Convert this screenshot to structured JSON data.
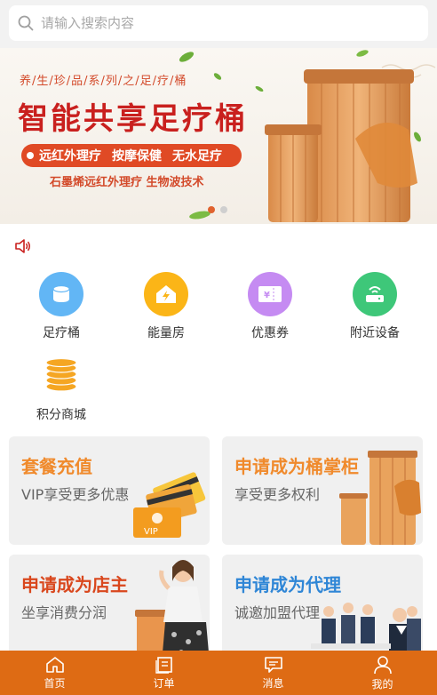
{
  "search": {
    "placeholder": "请输入搜索内容"
  },
  "banner": {
    "series": "养/生/珍/品/系/列/之/足/疗/桶",
    "title": "智能共享足疗桶",
    "features": [
      "远红外理疗",
      "按摩保健",
      "无水足疗"
    ],
    "subtitle": "石墨烯远红外理疗   生物波技术"
  },
  "grid": [
    {
      "label": "足疗桶",
      "icon": "bucket-icon",
      "color": "#62b6f5"
    },
    {
      "label": "能量房",
      "icon": "energy-house-icon",
      "color": "#fbb517"
    },
    {
      "label": "优惠券",
      "icon": "coupon-icon",
      "color": "#c58bf2"
    },
    {
      "label": "附近设备",
      "icon": "nearby-device-icon",
      "color": "#3ec779"
    },
    {
      "label": "积分商城",
      "icon": "points-coins-icon",
      "color": "#f5a623"
    }
  ],
  "cards": [
    {
      "title": "套餐充值",
      "subtitle": "VIP享受更多优惠",
      "title_color": "#f08a2c",
      "badge": "VIP"
    },
    {
      "title": "申请成为桶掌柜",
      "subtitle": "享受更多权利",
      "title_color": "#f08a2c"
    },
    {
      "title": "申请成为店主",
      "subtitle": "坐享消费分润",
      "title_color": "#d9471d"
    },
    {
      "title": "申请成为代理",
      "subtitle": "诚邀加盟代理",
      "title_color": "#2f86d6"
    }
  ],
  "tabbar": [
    {
      "label": "首页",
      "icon": "home-icon"
    },
    {
      "label": "订单",
      "icon": "order-icon"
    },
    {
      "label": "消息",
      "icon": "message-icon"
    },
    {
      "label": "我的",
      "icon": "profile-icon"
    }
  ]
}
